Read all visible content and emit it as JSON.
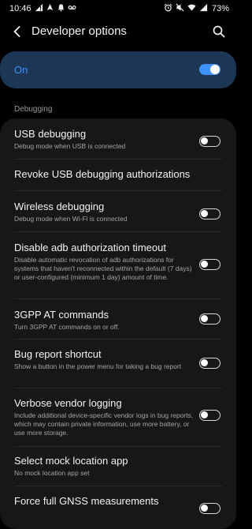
{
  "status_bar": {
    "time": "10:46",
    "battery": "73%",
    "left_icons": [
      "signal-alert-icon",
      "navigation-arrow-icon",
      "notification-bell-icon",
      "voicemail-icon"
    ],
    "right_icons": [
      "alarm-icon",
      "mute-icon",
      "wifi-icon",
      "cell-signal-icon"
    ]
  },
  "app_bar": {
    "title": "Developer options",
    "back_icon": "back-arrow-icon",
    "search_icon": "search-icon"
  },
  "master_switch": {
    "label": "On",
    "checked": true
  },
  "section": {
    "header": "Debugging"
  },
  "settings": [
    {
      "title": "USB debugging",
      "summary": "Debug mode when USB is connected",
      "toggle": false
    },
    {
      "title": "Revoke USB debugging authorizations",
      "summary": "",
      "toggle": null
    },
    {
      "title": "Wireless debugging",
      "summary": "Debug mode when Wi-Fi is connected",
      "toggle": false
    },
    {
      "title": "Disable adb authorization timeout",
      "summary": "Disable automatic revocation of adb authorizations for systems that haven't reconnected within the default (7 days) or user-configured (minimum 1 day) amount of time.",
      "toggle": false
    },
    {
      "title": "3GPP AT commands",
      "summary": "Turn 3GPP AT commands on or off.",
      "toggle": false
    },
    {
      "title": "Bug report shortcut",
      "summary": "Show a button in the power menu for taking a bug report",
      "toggle": false
    },
    {
      "title": "Verbose vendor logging",
      "summary": "Include additional device-specific vendor logs in bug reports, which may contain private information, use more battery, or use more storage.",
      "toggle": false
    },
    {
      "title": "Select mock location app",
      "summary": "No mock location app set",
      "toggle": null
    },
    {
      "title": "Force full GNSS measurements",
      "summary": "",
      "toggle": false
    }
  ],
  "colors": {
    "background": "#000000",
    "card": "#171717",
    "master_card": "#1d3654",
    "accent": "#3e91ff",
    "summary_text": "#a5a5a5"
  }
}
